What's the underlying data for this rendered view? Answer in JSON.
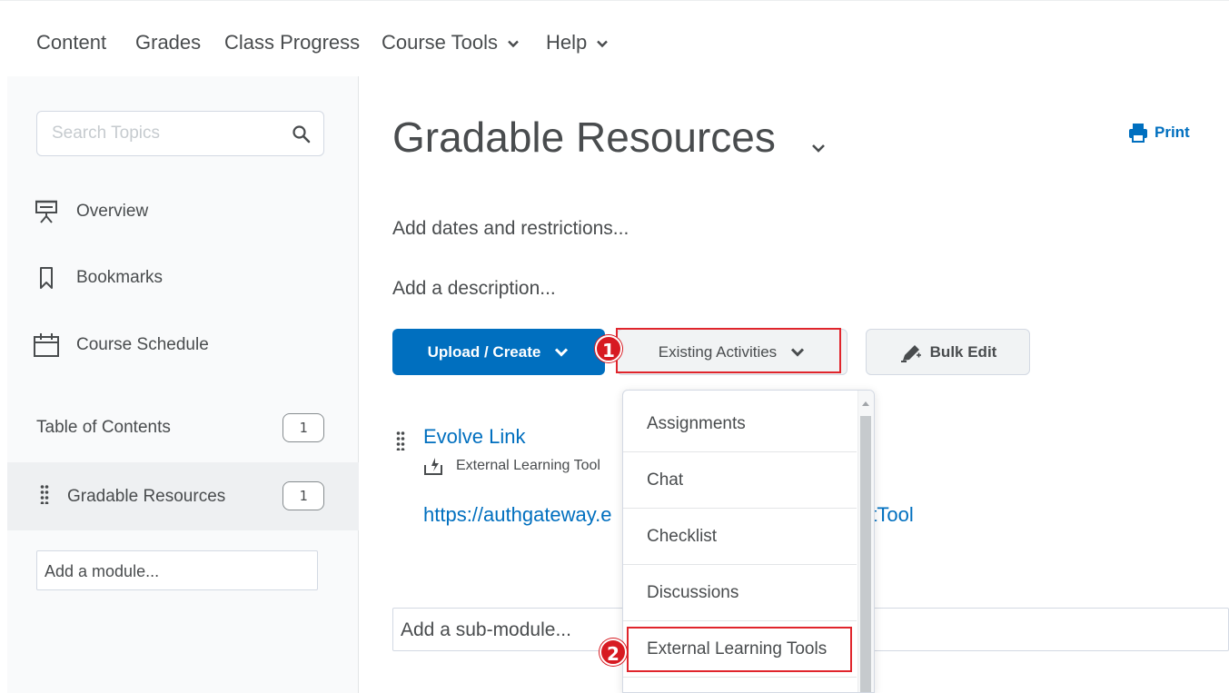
{
  "topnav": {
    "items": [
      {
        "label": "Content"
      },
      {
        "label": "Grades"
      },
      {
        "label": "Class Progress"
      },
      {
        "label": "Course Tools"
      },
      {
        "label": "Help"
      }
    ]
  },
  "sidebar": {
    "search": {
      "placeholder": "Search Topics"
    },
    "items": [
      {
        "label": "Overview",
        "icon": "overview-icon"
      },
      {
        "label": "Bookmarks",
        "icon": "bookmark-icon"
      },
      {
        "label": "Course Schedule",
        "icon": "calendar-icon"
      }
    ],
    "toc": {
      "label": "Table of Contents",
      "count": "1"
    },
    "module": {
      "label": "Gradable Resources",
      "count": "1"
    },
    "add_module": "Add a module..."
  },
  "main": {
    "title": "Gradable Resources",
    "print_label": "Print",
    "dates_link": "Add dates and restrictions...",
    "description_link": "Add a description...",
    "buttons": {
      "upload": "Upload / Create",
      "existing": "Existing Activities",
      "bulk": "Bulk Edit"
    },
    "topic": {
      "title": "Evolve Link",
      "type": "External Learning Tool",
      "url_start": "https://authgateway.e",
      "url_end": "ntTool"
    },
    "add_submodule": "Add a sub-module..."
  },
  "dropdown": {
    "options": [
      "Assignments",
      "Chat",
      "Checklist",
      "Discussions",
      "External Learning Tools"
    ]
  },
  "annotations": {
    "step1": "1",
    "step2": "2",
    "highlight_color": "#e0252c"
  },
  "colors": {
    "primary": "#006fbf",
    "text": "#494c4e"
  }
}
